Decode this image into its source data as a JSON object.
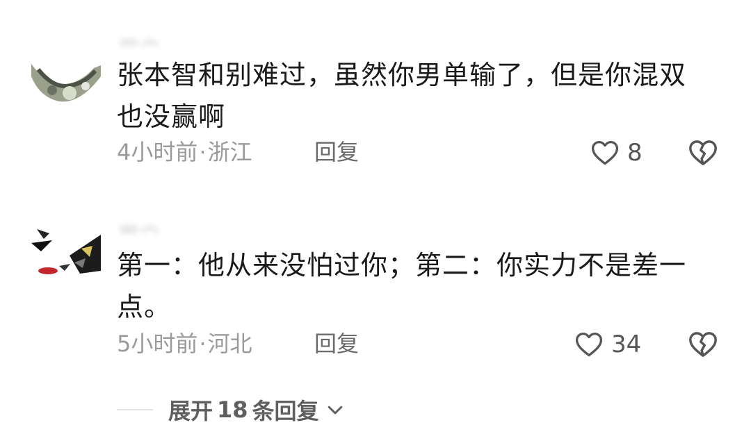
{
  "comments": [
    {
      "username": "用户 · ·",
      "text": "张本智和别难过，虽然你男单输了，但是你混双也没赢啊",
      "time": "4小时前",
      "location": "浙江",
      "reply_label": "回复",
      "likes": "8"
    },
    {
      "username": "用户",
      "text": "第一：他从来没怕过你；第二：你实力不是差一点。",
      "time": "5小时前",
      "location": "河北",
      "reply_label": "回复",
      "likes": "34"
    }
  ],
  "separator": "·",
  "expand": {
    "prefix": "展开",
    "count": "18",
    "suffix": "条回复"
  },
  "icons": {
    "like": "heart-outline-icon",
    "dislike": "broken-heart-icon",
    "expand": "chevron-down-icon"
  },
  "colors": {
    "text": "#1a1a1a",
    "meta": "#9a9a9a",
    "icon": "#555555"
  }
}
